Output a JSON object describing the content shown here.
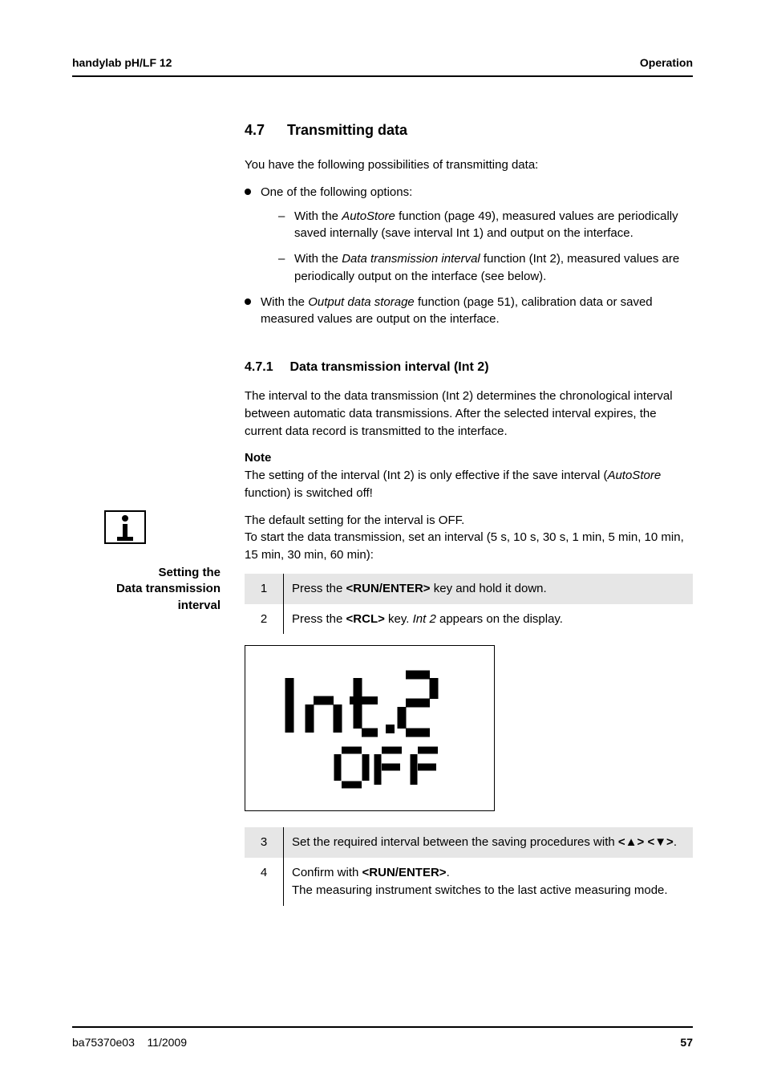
{
  "header": {
    "left": "handylab pH/LF 12",
    "right": "Operation"
  },
  "section": {
    "num": "4.7",
    "title": "Transmitting data",
    "intro": "You have the following possibilities of transmitting data:",
    "b1_lead": "One of the following options:",
    "b1a_pre": "With the ",
    "b1a_em": "AutoStore",
    "b1a_post": " function (page 49), measured values are periodically saved internally (save interval Int 1) and output on the interface.",
    "b1b_pre": "With the ",
    "b1b_em": "Data transmission interval",
    "b1b_post": " function (Int 2), measured values are periodically output on the interface (see below).",
    "b2_pre": "With the ",
    "b2_em": "Output data storage",
    "b2_post": " function (page 51), calibration data or saved measured values are output on the interface."
  },
  "sub": {
    "num": "4.7.1",
    "title": "Data transmission interval (Int 2)",
    "para": "The interval to the data transmission (Int 2) determines the chronological interval between automatic data transmissions. After the selected interval expires, the current data record is transmitted to the interface."
  },
  "note": {
    "heading": "Note",
    "text_pre": "The setting of the interval (Int 2) is only effective if the save interval (",
    "text_em": "AutoStore",
    "text_post": " function) is switched off!"
  },
  "margin": {
    "line1": "Setting the",
    "line2": "Data transmission",
    "line3": "interval"
  },
  "setting": {
    "p1": "The default setting for the interval is OFF.",
    "p2": "To start the data transmission, set an interval (5 s, 10 s, 30 s, 1 min, 5 min, 10 min, 15 min, 30 min, 60 min):"
  },
  "steps": {
    "n1": "1",
    "s1_pre": "Press the ",
    "s1_key": "<RUN/ENTER>",
    "s1_post": " key and hold it down.",
    "n2": "2",
    "s2_pre": "Press the ",
    "s2_key": "<RCL>",
    "s2_mid": " key. ",
    "s2_em": "Int 2",
    "s2_post": " appears on the display.",
    "n3": "3",
    "s3_pre": "Set the required interval between the saving procedures with ",
    "s3_key1": "<▲>",
    "s3_sep": " ",
    "s3_key2": "<▼>",
    "s3_post": ".",
    "n4": "4",
    "s4_pre": "Confirm with ",
    "s4_key": "<RUN/ENTER>",
    "s4_mid": ".",
    "s4_post": "The measuring instrument switches to the last active measuring mode."
  },
  "lcd": {
    "line1": "Int.2",
    "line2": "OFF"
  },
  "footer": {
    "left": "ba75370e03",
    "mid": "11/2009",
    "page": "57"
  }
}
